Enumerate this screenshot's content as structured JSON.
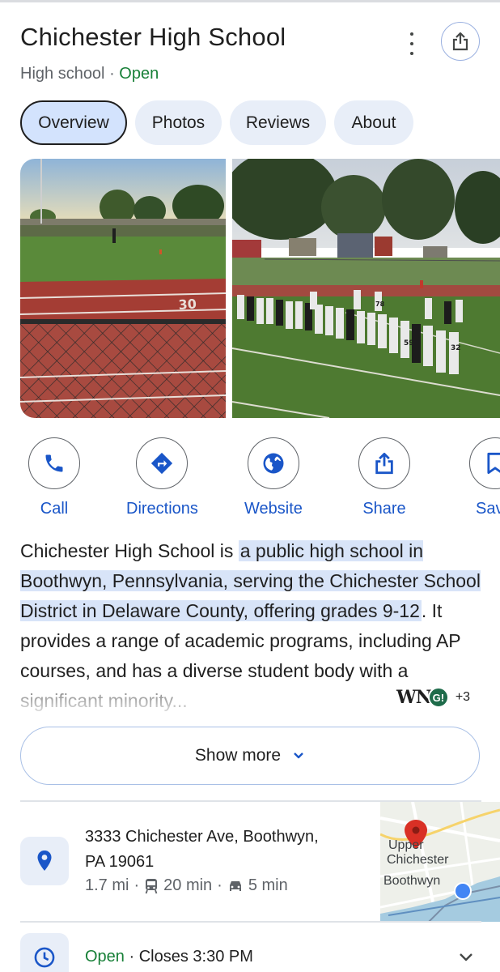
{
  "place": {
    "name": "Chichester High School",
    "category": "High school",
    "status": "Open"
  },
  "tabs": [
    {
      "label": "Overview",
      "active": true
    },
    {
      "label": "Photos",
      "active": false
    },
    {
      "label": "Reviews",
      "active": false
    },
    {
      "label": "About",
      "active": false
    }
  ],
  "photos": [
    {
      "alt": "Football field with running track and chain-link fence",
      "field_marking": "30"
    },
    {
      "alt": "Football team standing on field",
      "jersey_numbers": [
        "78",
        "59",
        "32"
      ]
    }
  ],
  "actions": [
    {
      "label": "Call",
      "icon": "phone-icon"
    },
    {
      "label": "Directions",
      "icon": "directions-icon"
    },
    {
      "label": "Website",
      "icon": "globe-icon"
    },
    {
      "label": "Share",
      "icon": "share-icon"
    },
    {
      "label": "Save",
      "icon": "bookmark-icon"
    }
  ],
  "description": {
    "lead": "Chichester High School is",
    "highlight": "a public high school in Boothwyn, Pennsylvania, serving the Chichester School District in Delaware County, offering grades 9-12",
    "rest": ". It provides a range of academic programs, including AP courses, and has a diverse student body with a significant minority..."
  },
  "sources": {
    "logo_text": "WN",
    "badge_text": "G!",
    "more": "+3"
  },
  "show_more": {
    "label": "Show more"
  },
  "address": {
    "line1": "3333 Chichester Ave, Boothwyn,",
    "line2": "PA 19061",
    "distance": "1.7 mi",
    "transit_time": "20 min",
    "drive_time": "5 min"
  },
  "map": {
    "labels": [
      "Upper",
      "Chichester",
      "Boothwyn"
    ]
  },
  "hours": {
    "status": "Open",
    "detail": "Closes 3:30 PM"
  },
  "colors": {
    "accent": "#1a56c8",
    "open": "#188038",
    "chip_bg": "#e8eef8",
    "chip_active": "#d3e3fd",
    "highlight": "#d8e4f8"
  }
}
